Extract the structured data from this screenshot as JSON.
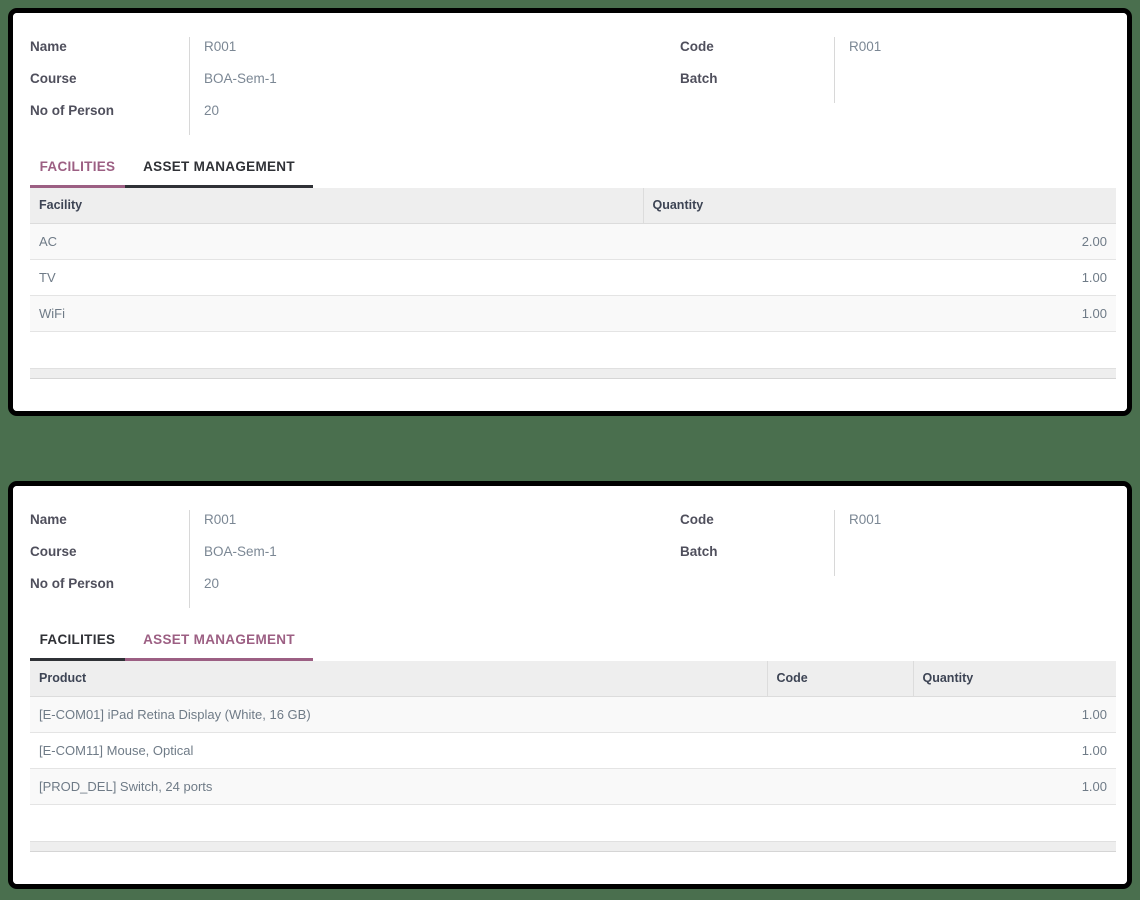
{
  "background_color": "#4a6f4e",
  "accent_color": "#9c5f83",
  "panels": [
    {
      "id": "facilities-panel",
      "form": {
        "left_fields": [
          {
            "label": "Name",
            "value": "R001"
          },
          {
            "label": "Course",
            "value": "BOA-Sem-1"
          },
          {
            "label": "No of Person",
            "value": "20"
          }
        ],
        "right_fields": [
          {
            "label": "Code",
            "value": "R001"
          },
          {
            "label": "Batch",
            "value": ""
          }
        ]
      },
      "tabs": [
        {
          "label": "FACILITIES",
          "active": true
        },
        {
          "label": "ASSET MANAGEMENT",
          "active": false
        }
      ],
      "table": {
        "columns": [
          "Facility",
          "Quantity"
        ],
        "rows": [
          [
            "AC",
            "2.00"
          ],
          [
            "TV",
            "1.00"
          ],
          [
            "WiFi",
            "1.00"
          ]
        ]
      }
    },
    {
      "id": "asset-management-panel",
      "form": {
        "left_fields": [
          {
            "label": "Name",
            "value": "R001"
          },
          {
            "label": "Course",
            "value": "BOA-Sem-1"
          },
          {
            "label": "No of Person",
            "value": "20"
          }
        ],
        "right_fields": [
          {
            "label": "Code",
            "value": "R001"
          },
          {
            "label": "Batch",
            "value": ""
          }
        ]
      },
      "tabs": [
        {
          "label": "FACILITIES",
          "active": false
        },
        {
          "label": "ASSET MANAGEMENT",
          "active": true
        }
      ],
      "table": {
        "columns": [
          "Product",
          "Code",
          "Quantity"
        ],
        "rows": [
          [
            "[E-COM01] iPad Retina Display (White, 16 GB)",
            "",
            "1.00"
          ],
          [
            "[E-COM11] Mouse, Optical",
            "",
            "1.00"
          ],
          [
            "[PROD_DEL] Switch, 24 ports",
            "",
            "1.00"
          ]
        ]
      }
    }
  ]
}
